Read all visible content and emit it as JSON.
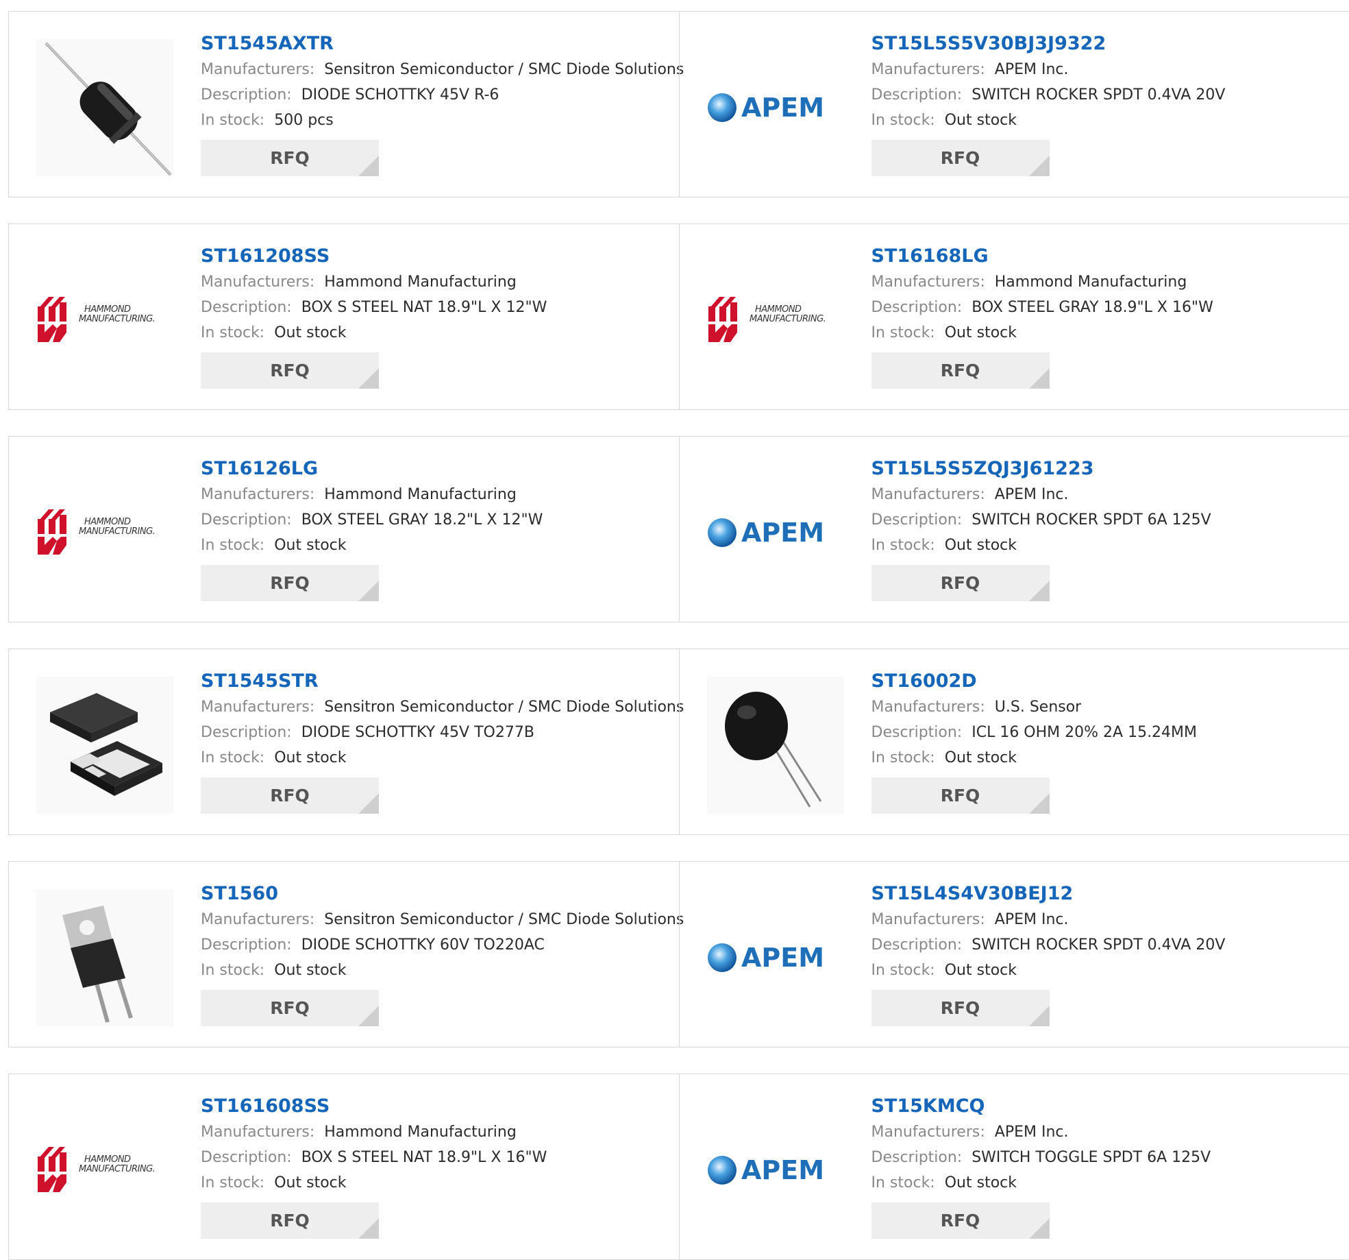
{
  "labels": {
    "manufacturers": "Manufacturers:",
    "description": "Description:",
    "in_stock": "In stock:",
    "rfq": "RFQ"
  },
  "logos": {
    "apem": "APEM",
    "hammond_line1": "HAMMOND",
    "hammond_line2": "MANUFACTURING."
  },
  "products": [
    {
      "part": "ST1545AXTR",
      "manufacturer": "Sensitron Semiconductor / SMC Diode Solutions",
      "description": "DIODE SCHOTTKY 45V R-6",
      "stock": "500 pcs",
      "image": "axial-diode-icon"
    },
    {
      "part": "ST15L5S5V30BJ3J9322",
      "manufacturer": "APEM Inc.",
      "description": "SWITCH ROCKER SPDT 0.4VA 20V",
      "stock": "Out stock",
      "image": "apem-logo"
    },
    {
      "part": "ST161208SS",
      "manufacturer": "Hammond Manufacturing",
      "description": "BOX S STEEL NAT 18.9\"L X 12\"W",
      "stock": "Out stock",
      "image": "hammond-logo"
    },
    {
      "part": "ST16168LG",
      "manufacturer": "Hammond Manufacturing",
      "description": "BOX STEEL GRAY 18.9\"L X 16\"W",
      "stock": "Out stock",
      "image": "hammond-logo"
    },
    {
      "part": "ST16126LG",
      "manufacturer": "Hammond Manufacturing",
      "description": "BOX STEEL GRAY 18.2\"L X 12\"W",
      "stock": "Out stock",
      "image": "hammond-logo"
    },
    {
      "part": "ST15L5S5ZQJ3J61223",
      "manufacturer": "APEM Inc.",
      "description": "SWITCH ROCKER SPDT 6A 125V",
      "stock": "Out stock",
      "image": "apem-logo"
    },
    {
      "part": "ST1545STR",
      "manufacturer": "Sensitron Semiconductor / SMC Diode Solutions",
      "description": "DIODE SCHOTTKY 45V TO277B",
      "stock": "Out stock",
      "image": "smd-package-icon"
    },
    {
      "part": "ST16002D",
      "manufacturer": "U.S. Sensor",
      "description": "ICL 16 OHM 20% 2A 15.24MM",
      "stock": "Out stock",
      "image": "thermistor-icon"
    },
    {
      "part": "ST1560",
      "manufacturer": "Sensitron Semiconductor / SMC Diode Solutions",
      "description": "DIODE SCHOTTKY 60V TO220AC",
      "stock": "Out stock",
      "image": "to220-package-icon"
    },
    {
      "part": "ST15L4S4V30BEJ12",
      "manufacturer": "APEM Inc.",
      "description": "SWITCH ROCKER SPDT 0.4VA 20V",
      "stock": "Out stock",
      "image": "apem-logo"
    },
    {
      "part": "ST161608SS",
      "manufacturer": "Hammond Manufacturing",
      "description": "BOX S STEEL NAT 18.9\"L X 16\"W",
      "stock": "Out stock",
      "image": "hammond-logo"
    },
    {
      "part": "ST15KMCQ",
      "manufacturer": "APEM Inc.",
      "description": "SWITCH TOGGLE SPDT 6A 125V",
      "stock": "Out stock",
      "image": "apem-logo"
    }
  ],
  "colors": {
    "part_link": "#1565b8",
    "label_gray": "#888888",
    "button_bg": "#eeeeee",
    "hammond_red": "#d0112b",
    "apem_blue": "#1e6fb8"
  }
}
